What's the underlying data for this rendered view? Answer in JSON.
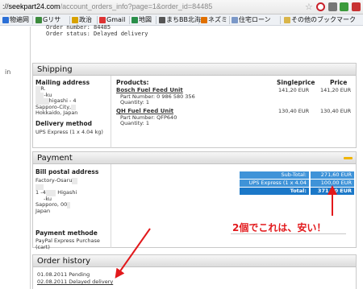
{
  "browser": {
    "url_host": "seekpart24.com",
    "url_path": "/account_orders_info?page=1&order_id=84485",
    "url_prefix": "://",
    "bookmarks": [
      {
        "label": "物遍网",
        "color": "#2b6fd6"
      },
      {
        "label": "Gリサ",
        "color": "#3c8b3c"
      },
      {
        "label": "政治",
        "color": "#d8a200"
      },
      {
        "label": "Gmail",
        "color": "#d33"
      },
      {
        "label": "地図",
        "color": "#2a8f4a"
      },
      {
        "label": "まちBB北海",
        "color": "#555"
      },
      {
        "label": "ネズミ",
        "color": "#e07000"
      },
      {
        "label": "住宅ローン",
        "color": "#7b98c8"
      },
      {
        "label": "その他のブックマーク",
        "color": "#d9b54a"
      }
    ],
    "bookmark_prefix": "in"
  },
  "order_info": {
    "number_line": "Order number: 84485",
    "status_line": "Order status: Delayed delivery"
  },
  "shipping": {
    "title": "Shipping",
    "mailing_title": "Mailing address",
    "mailing_lines": [
      "R.",
      "-ku",
      "higashi",
      "- 4",
      "Sapporo-City,",
      "Hokkaido, Japan"
    ],
    "delivery_title": "Delivery method",
    "delivery_value": "UPS Express (1 x 4.04 kg)",
    "headers": {
      "products": "Products:",
      "singleprice": "Singleprice",
      "price": "Price"
    },
    "products": [
      {
        "name": "Bosch Fuel Feed Unit",
        "part": "Part Number: 0 986 580 356",
        "qty": "Quantity: 1",
        "single": "141,20 EUR",
        "price": "141,20 EUR"
      },
      {
        "name": "QH Fuel Feed Unit",
        "part": "Part Number: QFP640",
        "qty": "Quantity: 1",
        "single": "130,40 EUR",
        "price": "130,40 EUR"
      }
    ]
  },
  "payment": {
    "title": "Payment",
    "billing_title": "Bill postal address",
    "billing_lines": [
      "Factory-Osaru",
      "1",
      "-4",
      "Higashi",
      "-ku",
      "Sapporo, 00",
      "Japan"
    ],
    "method_title": "Payment methode",
    "method_value": "PayPal Express Purchase (cart)",
    "totals": [
      {
        "label": "Sub-Total:",
        "value": "271,60 EUR"
      },
      {
        "label": "UPS Express (1 x 4.04 kg)",
        "value": "100,00 EUR"
      },
      {
        "label": "Total:",
        "value": "371,60 EUR"
      }
    ]
  },
  "annotation": {
    "note": "2個でこれは、安い！",
    "arrow_color": "#e2191c"
  },
  "order_history": {
    "title": "Order history",
    "entries": [
      {
        "text": "01.08.2011 Pending"
      },
      {
        "text": "02.08.2011 Delayed delivery"
      }
    ]
  }
}
